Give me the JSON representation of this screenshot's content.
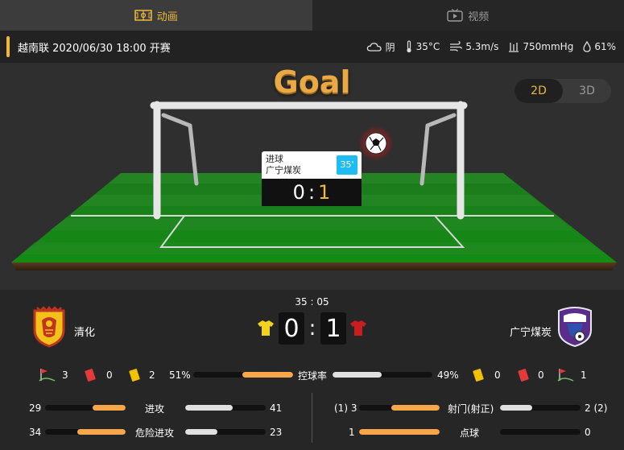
{
  "tabs": {
    "animation": "动画",
    "video": "视频"
  },
  "match": {
    "info": "越南联 2020/06/30 18:00 开赛",
    "weather": "阴",
    "temperature": "35°C",
    "wind": "5.3m/s",
    "pressure": "750mmHg",
    "humidity": "61%"
  },
  "stage": {
    "title": "Goal",
    "view_2d": "2D",
    "view_3d": "3D",
    "event": {
      "type": "进球",
      "team": "广宁煤炭",
      "minute": "35'",
      "home_score": "0",
      "sep": ":",
      "away_score": "1"
    }
  },
  "scoreboard": {
    "clock": "35 : 05",
    "home_team": "清化",
    "away_team": "广宁煤炭",
    "home_score": "0",
    "away_score": "1",
    "sep": ":"
  },
  "cards": {
    "home_corners": "3",
    "home_red": "0",
    "home_yellow": "2",
    "away_yellow": "0",
    "away_red": "0",
    "away_corners": "1"
  },
  "possession": {
    "label": "控球率",
    "home": "51%",
    "away": "49%",
    "home_value": 51,
    "away_value": 49
  },
  "stats": {
    "attack": {
      "label": "进攻",
      "home": "29",
      "away": "41",
      "home_value": 29,
      "away_value": 41
    },
    "dangerous": {
      "label": "危险进攻",
      "home": "34",
      "away": "23",
      "home_value": 34,
      "away_value": 23
    },
    "shots": {
      "label": "射门(射正)",
      "home": "(1) 3",
      "away": "2 (2)",
      "home_value": 3,
      "home_on": 1,
      "away_value": 2,
      "away_on": 2
    },
    "penalty": {
      "label": "点球",
      "home": "1",
      "away": "0",
      "home_value": 1,
      "away_value": 0
    }
  },
  "colors": {
    "accent": "#f0b83a",
    "home_bar": "#f7a64a",
    "away_bar": "#e0e0e0",
    "red_card": "#e23a3a",
    "yellow_card": "#f2c200",
    "minute_badge": "#1ebcf0"
  }
}
